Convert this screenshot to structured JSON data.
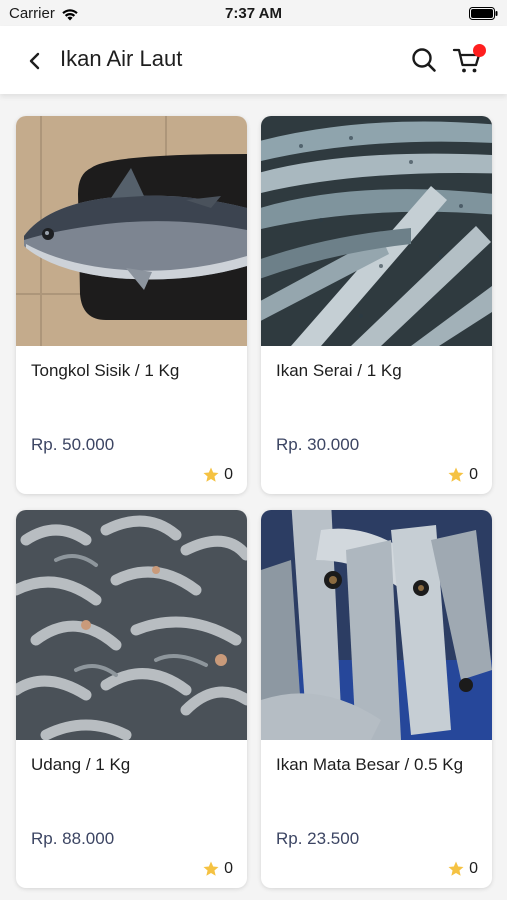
{
  "status_bar": {
    "carrier": "Carrier",
    "time": "7:37 AM"
  },
  "header": {
    "title": "Ikan Air Laut",
    "back_icon": "chevron-left-icon",
    "search_icon": "search-icon",
    "cart_icon": "cart-icon",
    "cart_badge_color": "#ff1f1f"
  },
  "products": [
    {
      "name": "Tongkol Sisik / 1 Kg",
      "price": "Rp. 50.000",
      "rating": "0",
      "image": "tuna-fish-photo"
    },
    {
      "name": "Ikan Serai / 1 Kg",
      "price": "Rp. 30.000",
      "rating": "0",
      "image": "mackerel-pile-photo"
    },
    {
      "name": "Udang / 1 Kg",
      "price": "Rp. 88.000",
      "rating": "0",
      "image": "shrimp-pile-photo"
    },
    {
      "name": "Ikan Mata Besar / 0.5 Kg",
      "price": "Rp. 23.500",
      "rating": "0",
      "image": "bigeye-fish-photo"
    }
  ],
  "colors": {
    "price": "#3c4563",
    "star": "#f5c242",
    "background": "#f4f4f4"
  }
}
